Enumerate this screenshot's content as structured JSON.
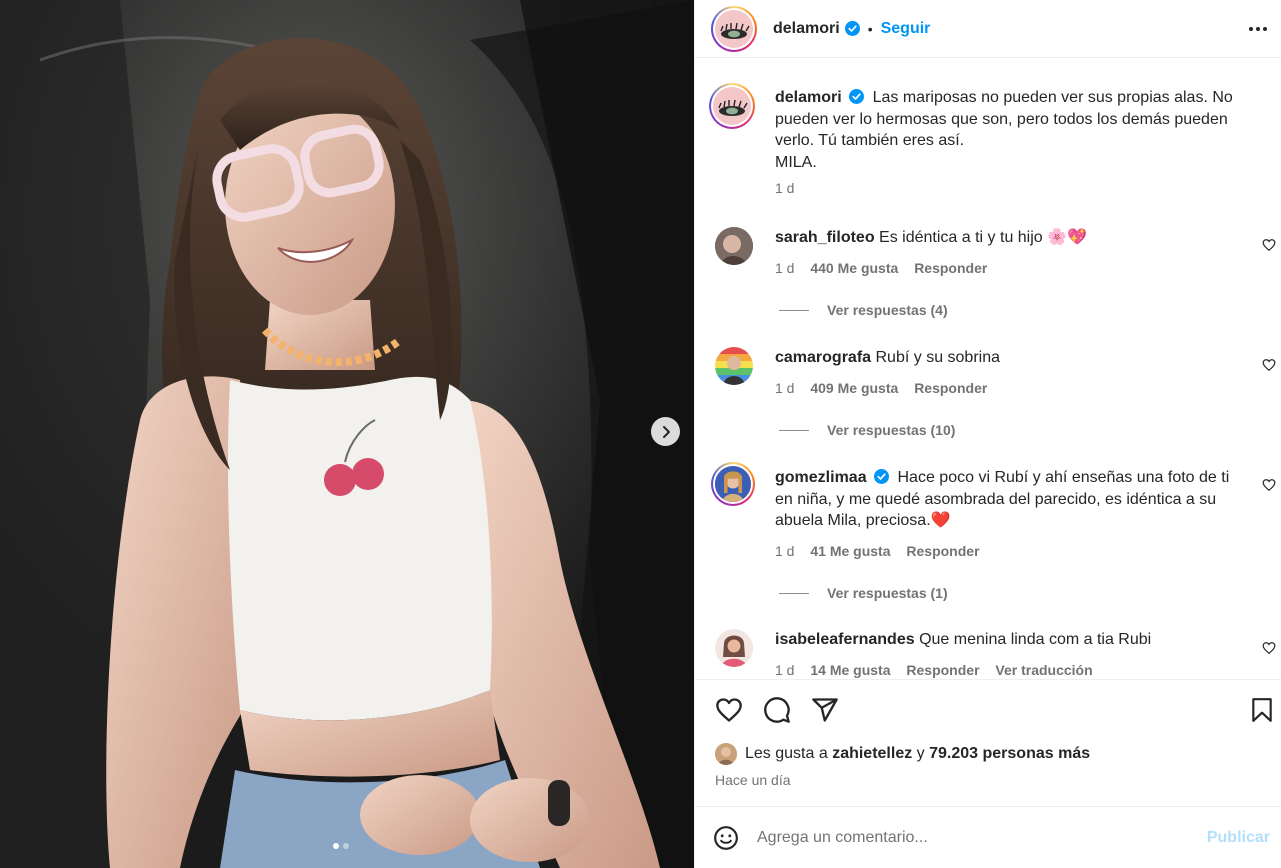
{
  "post": {
    "username": "delamori",
    "follow_label": "Seguir",
    "bullet": "•",
    "caption_text": "Las mariposas no pueden ver sus propias alas. No pueden ver lo hermosas que son, pero todos los demás pueden verlo. Tú también eres así.",
    "caption_sign": "MILA.",
    "caption_time": "1 d"
  },
  "comments": [
    {
      "username": "sarah_filoteo",
      "text": "Es idéntica a ti y tu hijo 🌸💖",
      "time": "1 d",
      "likes": "440 Me gusta",
      "reply": "Responder",
      "view_replies": "Ver respuestas (4)"
    },
    {
      "username": "camarografa",
      "text": "Rubí y su sobrina",
      "time": "1 d",
      "likes": "409 Me gusta",
      "reply": "Responder",
      "view_replies": "Ver respuestas (10)"
    },
    {
      "username": "gomezlimaa",
      "text": "Hace poco vi Rubí y ahí enseñas una foto de ti en niña, y me quedé asombrada del parecido, es idéntica a su abuela Mila, preciosa.❤️",
      "time": "1 d",
      "likes": "41 Me gusta",
      "reply": "Responder",
      "view_replies": "Ver respuestas (1)"
    },
    {
      "username": "isabeleafernandes",
      "text": "Que menina linda com a tia Rubi",
      "time": "1 d",
      "likes": "14 Me gusta",
      "reply": "Responder",
      "translate": "Ver traducción"
    }
  ],
  "likes_summary": {
    "prefix": "Les gusta a",
    "user": "zahietellez",
    "middle": "y",
    "others": "79.203 personas más"
  },
  "posted_ago": "Hace un día",
  "comment_box": {
    "placeholder": "Agrega un comentario...",
    "publish_label": "Publicar"
  },
  "carousel": {
    "total": 2,
    "current": 1
  },
  "colors": {
    "link_blue": "#0095f6",
    "verified_blue": "#0095f6",
    "muted_text": "#737373",
    "publish_disabled": "#b2dffc"
  },
  "icons": [
    "verified-badge-icon",
    "more-options-icon",
    "heart-icon",
    "comment-icon",
    "share-icon",
    "bookmark-icon",
    "emoji-icon",
    "chevron-right-icon"
  ]
}
